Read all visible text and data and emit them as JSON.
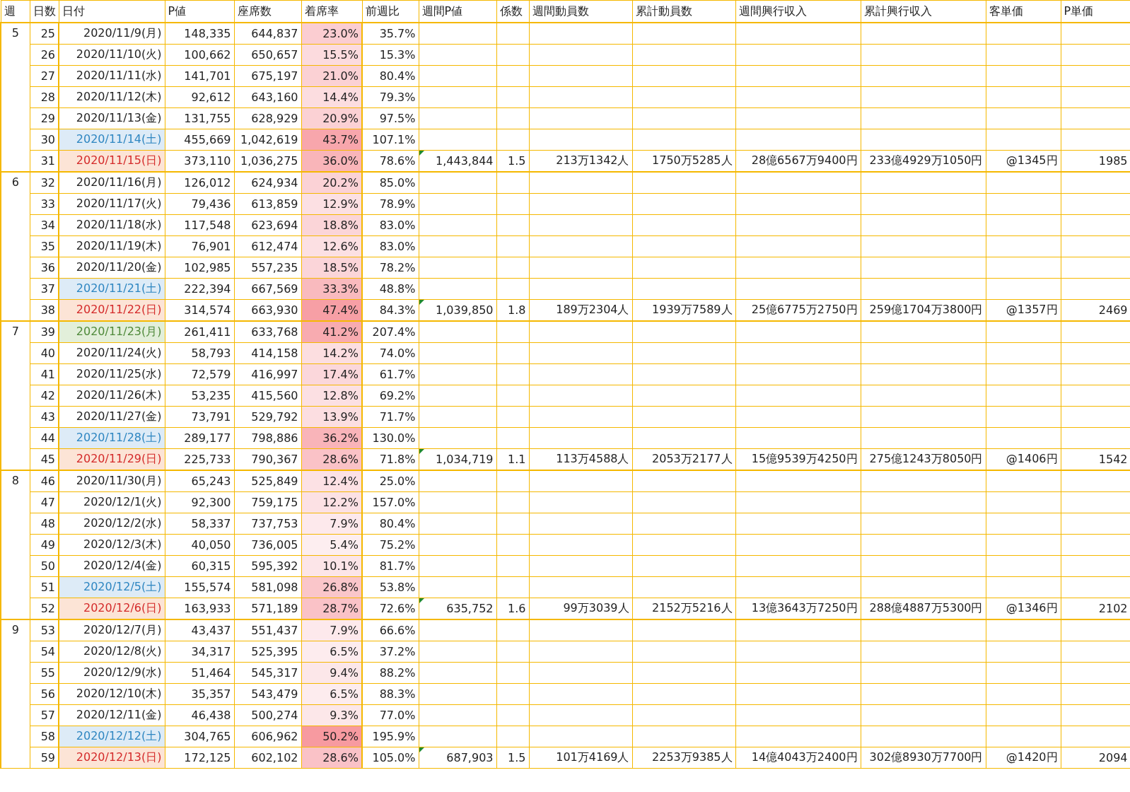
{
  "columns": [
    "週",
    "日数",
    "日付",
    "P値",
    "座席数",
    "着席率",
    "前週比",
    "週間P値",
    "係数",
    "週間動員数",
    "累計動員数",
    "週間興行収入",
    "累計興行収入",
    "客単価",
    "P単価"
  ],
  "weeks": [
    {
      "week": "5",
      "days": [
        {
          "day": "25",
          "date": "2020/11/9(月)",
          "kind": "weekday",
          "p_value": "148,335",
          "seats": "644,837",
          "occupancy": "23.0%",
          "color": "#fbcdd1",
          "week_over_week": "35.7%"
        },
        {
          "day": "26",
          "date": "2020/11/10(火)",
          "kind": "weekday",
          "p_value": "100,662",
          "seats": "650,657",
          "occupancy": "15.5%",
          "color": "#fcdbde",
          "week_over_week": "15.3%"
        },
        {
          "day": "27",
          "date": "2020/11/11(水)",
          "kind": "weekday",
          "p_value": "141,701",
          "seats": "675,197",
          "occupancy": "21.0%",
          "color": "#fbd1d4",
          "week_over_week": "80.4%"
        },
        {
          "day": "28",
          "date": "2020/11/12(木)",
          "kind": "weekday",
          "p_value": "92,612",
          "seats": "643,160",
          "occupancy": "14.4%",
          "color": "#fcdde0",
          "week_over_week": "79.3%"
        },
        {
          "day": "29",
          "date": "2020/11/13(金)",
          "kind": "weekday",
          "p_value": "131,755",
          "seats": "628,929",
          "occupancy": "20.9%",
          "color": "#fbd1d4",
          "week_over_week": "97.5%"
        },
        {
          "day": "30",
          "date": "2020/11/14(土)",
          "kind": "saturday",
          "p_value": "455,669",
          "seats": "1,042,619",
          "occupancy": "43.7%",
          "color": "#f8a6ac",
          "week_over_week": "107.1%"
        },
        {
          "day": "31",
          "date": "2020/11/15(日)",
          "kind": "sunday",
          "p_value": "373,110",
          "seats": "1,036,275",
          "occupancy": "36.0%",
          "color": "#f9b5b9",
          "week_over_week": "78.6%"
        }
      ],
      "summary": {
        "flagged": true,
        "weekly_p_value": "1,443,844",
        "coefficient": "1.5",
        "weekly_attendance": "213万1342人",
        "total_attendance": "1750万5285人",
        "weekly_revenue": "28億6567万9400円",
        "total_revenue": "233億4929万1050円",
        "revenue_per_customer": "@1345円",
        "p_unit_price": "1985"
      }
    },
    {
      "week": "6",
      "days": [
        {
          "day": "32",
          "date": "2020/11/16(月)",
          "kind": "weekday",
          "p_value": "126,012",
          "seats": "624,934",
          "occupancy": "20.2%",
          "color": "#fbd2d6",
          "week_over_week": "85.0%"
        },
        {
          "day": "33",
          "date": "2020/11/17(火)",
          "kind": "weekday",
          "p_value": "79,436",
          "seats": "613,859",
          "occupancy": "12.9%",
          "color": "#fce0e3",
          "week_over_week": "78.9%"
        },
        {
          "day": "34",
          "date": "2020/11/18(水)",
          "kind": "weekday",
          "p_value": "117,548",
          "seats": "623,694",
          "occupancy": "18.8%",
          "color": "#fbd5d8",
          "week_over_week": "83.0%"
        },
        {
          "day": "35",
          "date": "2020/11/19(木)",
          "kind": "weekday",
          "p_value": "76,901",
          "seats": "612,474",
          "occupancy": "12.6%",
          "color": "#fce0e3",
          "week_over_week": "83.0%"
        },
        {
          "day": "36",
          "date": "2020/11/20(金)",
          "kind": "weekday",
          "p_value": "102,985",
          "seats": "557,235",
          "occupancy": "18.5%",
          "color": "#fbd5d9",
          "week_over_week": "78.2%"
        },
        {
          "day": "37",
          "date": "2020/11/21(土)",
          "kind": "saturday",
          "p_value": "222,394",
          "seats": "667,569",
          "occupancy": "33.3%",
          "color": "#f9babe",
          "week_over_week": "48.8%"
        },
        {
          "day": "38",
          "date": "2020/11/22(日)",
          "kind": "sunday",
          "p_value": "314,574",
          "seats": "663,930",
          "occupancy": "47.4%",
          "color": "#f79fa5",
          "week_over_week": "84.3%"
        }
      ],
      "summary": {
        "flagged": true,
        "weekly_p_value": "1,039,850",
        "coefficient": "1.8",
        "weekly_attendance": "189万2304人",
        "total_attendance": "1939万7589人",
        "weekly_revenue": "25億6775万2750円",
        "total_revenue": "259億1704万3800円",
        "revenue_per_customer": "@1357円",
        "p_unit_price": "2469"
      }
    },
    {
      "week": "7",
      "days": [
        {
          "day": "39",
          "date": "2020/11/23(月)",
          "kind": "holiday",
          "p_value": "261,411",
          "seats": "633,768",
          "occupancy": "41.2%",
          "color": "#f8abb0",
          "week_over_week": "207.4%"
        },
        {
          "day": "40",
          "date": "2020/11/24(火)",
          "kind": "weekday",
          "p_value": "58,793",
          "seats": "414,158",
          "occupancy": "14.2%",
          "color": "#fcdee0",
          "week_over_week": "74.0%"
        },
        {
          "day": "41",
          "date": "2020/11/25(水)",
          "kind": "weekday",
          "p_value": "72,579",
          "seats": "416,997",
          "occupancy": "17.4%",
          "color": "#fbd7db",
          "week_over_week": "61.7%"
        },
        {
          "day": "42",
          "date": "2020/11/26(木)",
          "kind": "weekday",
          "p_value": "53,235",
          "seats": "415,560",
          "occupancy": "12.8%",
          "color": "#fce0e3",
          "week_over_week": "69.2%"
        },
        {
          "day": "43",
          "date": "2020/11/27(金)",
          "kind": "weekday",
          "p_value": "73,791",
          "seats": "529,792",
          "occupancy": "13.9%",
          "color": "#fcdee1",
          "week_over_week": "71.7%"
        },
        {
          "day": "44",
          "date": "2020/11/28(土)",
          "kind": "saturday",
          "p_value": "289,177",
          "seats": "798,886",
          "occupancy": "36.2%",
          "color": "#f9b4b9",
          "week_over_week": "130.0%"
        },
        {
          "day": "45",
          "date": "2020/11/29(日)",
          "kind": "sunday",
          "p_value": "225,733",
          "seats": "790,367",
          "occupancy": "28.6%",
          "color": "#fac2c7",
          "week_over_week": "71.8%"
        }
      ],
      "summary": {
        "flagged": true,
        "weekly_p_value": "1,034,719",
        "coefficient": "1.1",
        "weekly_attendance": "113万4588人",
        "total_attendance": "2053万2177人",
        "weekly_revenue": "15億9539万4250円",
        "total_revenue": "275億1243万8050円",
        "revenue_per_customer": "@1406円",
        "p_unit_price": "1542"
      }
    },
    {
      "week": "8",
      "days": [
        {
          "day": "46",
          "date": "2020/11/30(月)",
          "kind": "weekday",
          "p_value": "65,243",
          "seats": "525,849",
          "occupancy": "12.4%",
          "color": "#fce1e4",
          "week_over_week": "25.0%"
        },
        {
          "day": "47",
          "date": "2020/12/1(火)",
          "kind": "weekday",
          "p_value": "92,300",
          "seats": "759,175",
          "occupancy": "12.2%",
          "color": "#fce1e4",
          "week_over_week": "157.0%"
        },
        {
          "day": "48",
          "date": "2020/12/2(水)",
          "kind": "weekday",
          "p_value": "58,337",
          "seats": "737,753",
          "occupancy": "7.9%",
          "color": "#fde9ec",
          "week_over_week": "80.4%"
        },
        {
          "day": "49",
          "date": "2020/12/3(木)",
          "kind": "weekday",
          "p_value": "40,050",
          "seats": "736,005",
          "occupancy": "5.4%",
          "color": "#fdeef0",
          "week_over_week": "75.2%"
        },
        {
          "day": "50",
          "date": "2020/12/4(金)",
          "kind": "weekday",
          "p_value": "60,315",
          "seats": "595,392",
          "occupancy": "10.1%",
          "color": "#fce5e8",
          "week_over_week": "81.7%"
        },
        {
          "day": "51",
          "date": "2020/12/5(土)",
          "kind": "saturday",
          "p_value": "155,574",
          "seats": "581,098",
          "occupancy": "26.8%",
          "color": "#fac6ca",
          "week_over_week": "53.8%"
        },
        {
          "day": "52",
          "date": "2020/12/6(日)",
          "kind": "sunday",
          "p_value": "163,933",
          "seats": "571,189",
          "occupancy": "28.7%",
          "color": "#fac2c7",
          "week_over_week": "72.6%"
        }
      ],
      "summary": {
        "flagged": true,
        "weekly_p_value": "635,752",
        "coefficient": "1.6",
        "weekly_attendance": "99万3039人",
        "total_attendance": "2152万5216人",
        "weekly_revenue": "13億3643万7250円",
        "total_revenue": "288億4887万5300円",
        "revenue_per_customer": "@1346円",
        "p_unit_price": "2102"
      }
    },
    {
      "week": "9",
      "days": [
        {
          "day": "53",
          "date": "2020/12/7(月)",
          "kind": "weekday",
          "p_value": "43,437",
          "seats": "551,437",
          "occupancy": "7.9%",
          "color": "#fde9ec",
          "week_over_week": "66.6%"
        },
        {
          "day": "54",
          "date": "2020/12/8(火)",
          "kind": "weekday",
          "p_value": "34,317",
          "seats": "525,395",
          "occupancy": "6.5%",
          "color": "#fdecee",
          "week_over_week": "37.2%"
        },
        {
          "day": "55",
          "date": "2020/12/9(水)",
          "kind": "weekday",
          "p_value": "51,464",
          "seats": "545,317",
          "occupancy": "9.4%",
          "color": "#fce7e9",
          "week_over_week": "88.2%"
        },
        {
          "day": "56",
          "date": "2020/12/10(木)",
          "kind": "weekday",
          "p_value": "35,357",
          "seats": "543,479",
          "occupancy": "6.5%",
          "color": "#fdecee",
          "week_over_week": "88.3%"
        },
        {
          "day": "57",
          "date": "2020/12/11(金)",
          "kind": "weekday",
          "p_value": "46,438",
          "seats": "500,274",
          "occupancy": "9.3%",
          "color": "#fce7e9",
          "week_over_week": "77.0%"
        },
        {
          "day": "58",
          "date": "2020/12/12(土)",
          "kind": "saturday",
          "p_value": "304,765",
          "seats": "606,962",
          "occupancy": "50.2%",
          "color": "#f79aa0",
          "week_over_week": "195.9%"
        },
        {
          "day": "59",
          "date": "2020/12/13(日)",
          "kind": "sunday",
          "p_value": "172,125",
          "seats": "602,102",
          "occupancy": "28.6%",
          "color": "#fac2c7",
          "week_over_week": "105.0%"
        }
      ],
      "summary": {
        "flagged": true,
        "weekly_p_value": "687,903",
        "coefficient": "1.5",
        "weekly_attendance": "101万4169人",
        "total_attendance": "2253万9385人",
        "weekly_revenue": "14億4043万2400円",
        "total_revenue": "302億8930万7700円",
        "revenue_per_customer": "@1420円",
        "p_unit_price": "2094"
      }
    }
  ]
}
